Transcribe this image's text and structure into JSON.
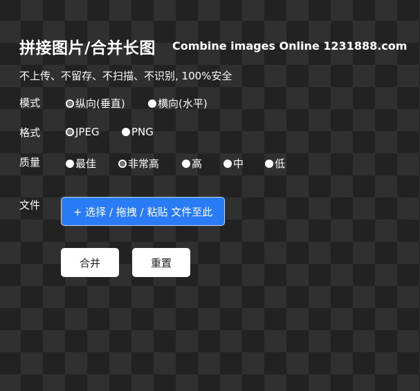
{
  "header": {
    "title": "拼接图片/合并长图",
    "subtitle": "Combine images Online  1231888.com"
  },
  "notice": "不上传、不留存、不扫描、不识别, 100%安全",
  "mode": {
    "label": "模式",
    "options": [
      {
        "label": "纵向(垂直)",
        "checked": true
      },
      {
        "label": "横向(水平)",
        "checked": false
      }
    ]
  },
  "format": {
    "label": "格式",
    "options": [
      {
        "label": "JPEG",
        "checked": true
      },
      {
        "label": "PNG",
        "checked": false
      }
    ]
  },
  "quality": {
    "label": "质量",
    "options": [
      {
        "label": "最佳",
        "checked": false
      },
      {
        "label": "非常高",
        "checked": true
      },
      {
        "label": "高",
        "checked": false
      },
      {
        "label": "中",
        "checked": false
      },
      {
        "label": "低",
        "checked": false
      }
    ]
  },
  "file": {
    "label": "文件",
    "button_label": "+ 选择 / 拖拽 / 粘贴 文件至此"
  },
  "actions": {
    "merge_label": "合并",
    "reset_label": "重置"
  },
  "colors": {
    "primary": "#2a7bf6"
  }
}
